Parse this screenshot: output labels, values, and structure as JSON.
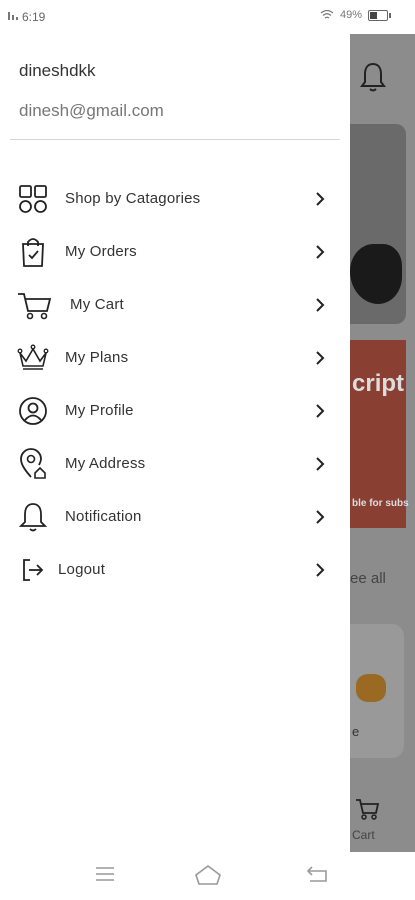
{
  "status_bar": {
    "time": "6:19",
    "battery": "49%"
  },
  "drawer": {
    "user_name": "dineshdkk",
    "user_email": "dinesh@gmail.com",
    "items": [
      {
        "label": "Shop by Catagories",
        "icon": "grid-icon"
      },
      {
        "label": "My Orders",
        "icon": "shopping-bag-icon"
      },
      {
        "label": "My Cart",
        "icon": "cart-icon"
      },
      {
        "label": "My Plans",
        "icon": "crown-icon"
      },
      {
        "label": "My Profile",
        "icon": "user-circle-icon"
      },
      {
        "label": "My Address",
        "icon": "location-pin-icon"
      },
      {
        "label": "Notification",
        "icon": "bell-icon"
      },
      {
        "label": "Logout",
        "icon": "logout-icon"
      }
    ]
  },
  "background": {
    "banner_title": "cript",
    "banner_sub": "ble for subs",
    "see_all": "ee all",
    "card_text": "e",
    "cart_label": "Cart"
  }
}
